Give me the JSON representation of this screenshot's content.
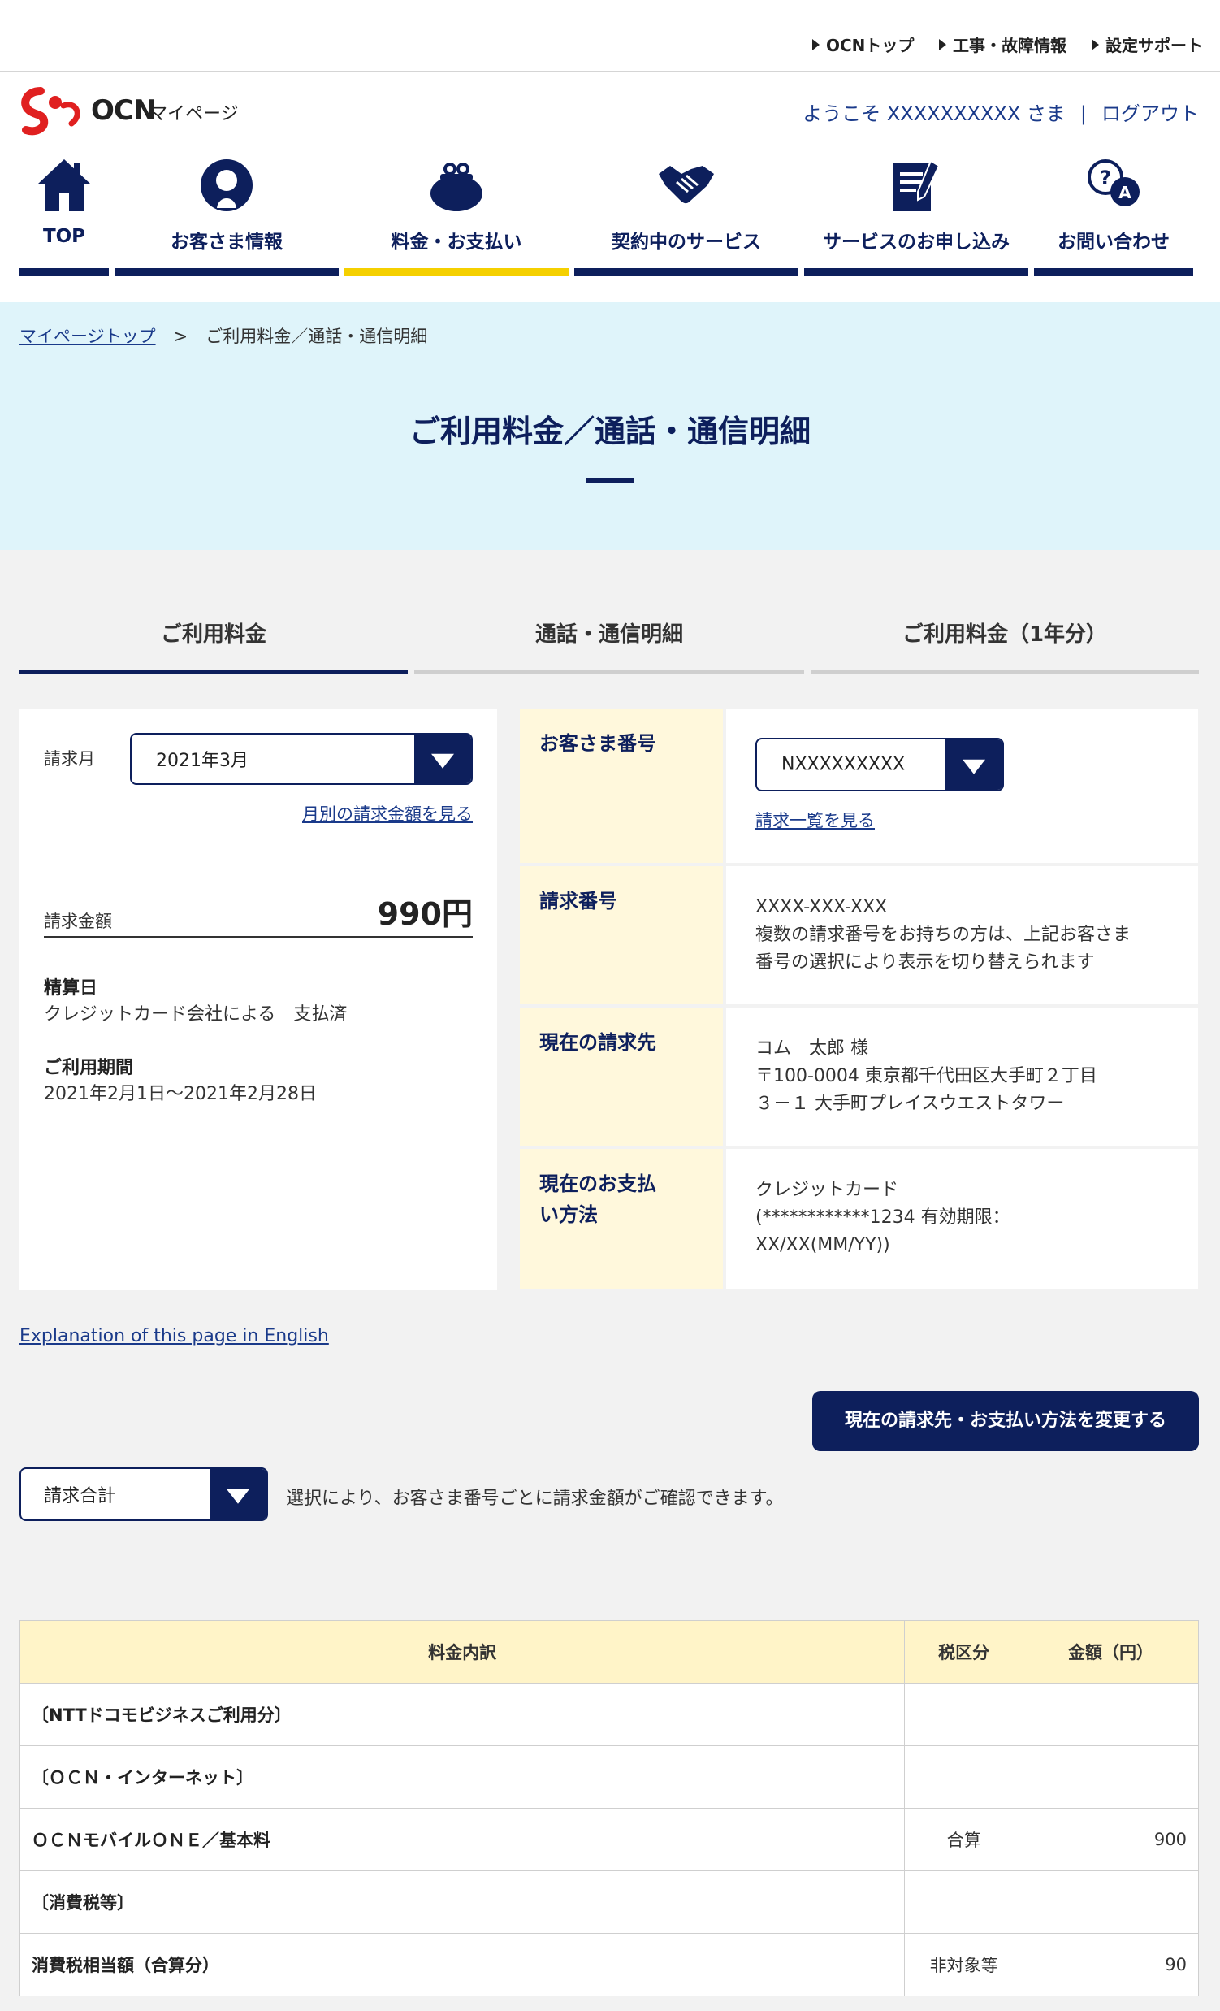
{
  "utility_links": [
    "OCNトップ",
    "工事・故障情報",
    "設定サポート"
  ],
  "header": {
    "logo_text": "OCN",
    "logo_sub": "マイページ",
    "welcome": "ようこそ XXXXXXXXXX さま",
    "separator": "|",
    "logout": "ログアウト"
  },
  "nav": [
    {
      "label": "TOP",
      "icon": "home-icon"
    },
    {
      "label": "お客さま情報",
      "icon": "user-icon"
    },
    {
      "label": "料金・お支払い",
      "icon": "purse-icon",
      "active": true
    },
    {
      "label": "契約中のサービス",
      "icon": "handshake-icon"
    },
    {
      "label": "サービスのお申し込み",
      "icon": "document-pen-icon"
    },
    {
      "label": "お問い合わせ",
      "icon": "question-bubble-icon"
    }
  ],
  "breadcrumb": {
    "home": "マイページトップ",
    "separator": ">",
    "current": "ご利用料金／通話・通信明細"
  },
  "page_title": "ご利用料金／通話・通信明細",
  "tabs": [
    {
      "label": "ご利用料金",
      "active": true
    },
    {
      "label": "通話・通信明細"
    },
    {
      "label": "ご利用料金（1年分）"
    }
  ],
  "billing": {
    "month_label": "請求月",
    "month_value": "2021年3月",
    "monthly_link": "月別の請求金額を見る",
    "amount_label": "請求金額",
    "amount_value": "990円",
    "settle_label": "精算日",
    "settle_value": "クレジットカード会社による　支払済",
    "period_label": "ご利用期間",
    "period_value": "2021年2月1日～2021年2月28日"
  },
  "info": {
    "customer_label": "お客さま番号",
    "customer_value": "NXXXXXXXXX",
    "invoice_list_link": "請求一覧を見る",
    "invoice_label": "請求番号",
    "invoice_lines": [
      "XXXX-XXX-XXX",
      "複数の請求番号をお持ちの方は、上記お客さま",
      "番号の選択により表示を切り替えられます"
    ],
    "billto_label": "現在の請求先",
    "billto_lines": [
      "コム　太郎 様",
      "〒100-0004 東京都千代田区大手町２丁目",
      "３－１ 大手町プレイスウエストタワー"
    ],
    "payment_label_lines": [
      "現在のお支払",
      "い方法"
    ],
    "payment_lines": [
      "クレジットカード",
      "(************1234 有効期限：",
      "XX/XX(MM/YY))"
    ]
  },
  "english_link": "Explanation of this page in English",
  "change_button": "現在の請求先・お支払い方法を変更する",
  "total_select": "請求合計",
  "total_note": "選択により、お客さま番号ごとに請求金額がご確認できます。",
  "fee_table": {
    "headers": [
      "料金内訳",
      "税区分",
      "金額（円）"
    ],
    "rows": [
      {
        "item": "〔NTTドコモビジネスご利用分〕",
        "tax": "",
        "amount": ""
      },
      {
        "item": "〔ＯＣＮ・インターネット〕",
        "tax": "",
        "amount": ""
      },
      {
        "item": "ＯＣＮモバイルＯＮＥ／基本料",
        "tax": "合算",
        "amount": "900"
      },
      {
        "item": "〔消費税等〕",
        "tax": "",
        "amount": ""
      },
      {
        "item": "消費税相当額（合算分）",
        "tax": "非対象等",
        "amount": "90"
      }
    ]
  },
  "colors": {
    "navy": "#0d1f5c",
    "accent_yellow": "#f5d000",
    "hero_bg": "#dff4fa",
    "label_bg": "#fff8dc"
  }
}
